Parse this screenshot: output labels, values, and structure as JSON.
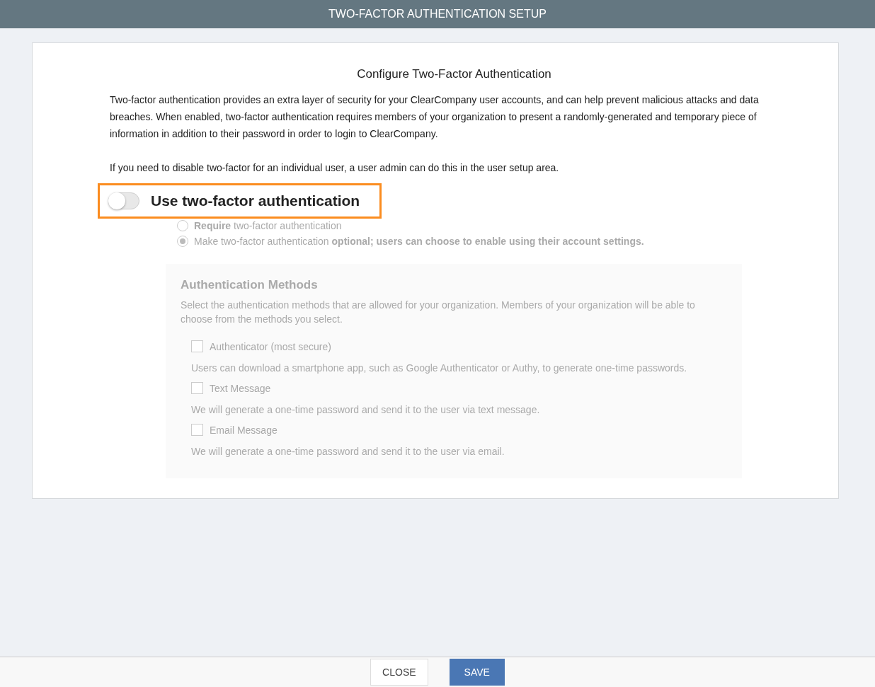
{
  "header": {
    "title": "TWO-FACTOR AUTHENTICATION SETUP"
  },
  "card": {
    "heading": "Configure Two-Factor Authentication",
    "paragraphs": [
      "Two-factor authentication provides an extra layer of security for your ClearCompany user accounts, and can help prevent malicious attacks and data breaches. When enabled, two-factor authentication requires members of your organization to present a randomly-generated and temporary piece of information in addition to their password in order to login to ClearCompany.",
      "If you need to disable two-factor for an individual user, a user admin can do this in the user setup area."
    ],
    "toggle": {
      "label": "Use two-factor authentication",
      "on": false,
      "highlighted": true
    },
    "options": {
      "disabled": true,
      "items": [
        {
          "label": "**Require** two-factor authentication",
          "selected": false
        },
        {
          "label": "Make two-factor authentication **optional; users can choose to enable using their account settings.**",
          "selected": true
        }
      ]
    },
    "methods": {
      "disabled": true,
      "title": "Authentication Methods",
      "description": "Select the authentication methods that are allowed for your organization. Members of your organization will be able to choose from the methods you select.",
      "items": [
        {
          "label": "Authenticator (most secure)",
          "checked": false,
          "description": "Users can download a smartphone app, such as Google Authenticator or Authy, to generate one-time passwords."
        },
        {
          "label": "Text Message",
          "checked": false,
          "description": "We will generate a one-time password and send it to the user via text message."
        },
        {
          "label": "Email Message",
          "checked": false,
          "description": "We will generate a one-time password and send it to the user via email."
        }
      ]
    }
  },
  "footer": {
    "buttons": [
      {
        "label": "CLOSE",
        "kind": "secondary"
      },
      {
        "label": "SAVE",
        "kind": "primary"
      }
    ]
  }
}
